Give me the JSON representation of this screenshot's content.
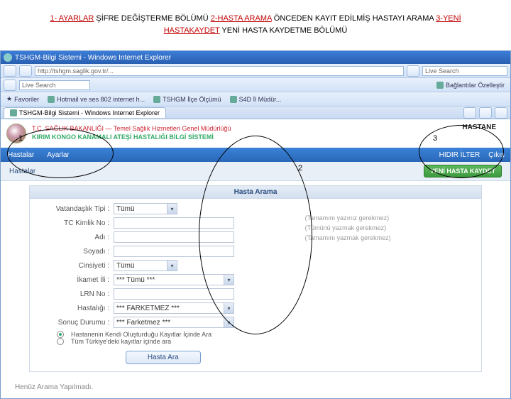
{
  "caption": {
    "seg1_label": "1- AYARLAR",
    "seg1_rest": " ŞİFRE DEĞİŞTERME BÖLÜMÜ ",
    "seg2_label": "2-HASTA ARAMA",
    "seg2_rest": " ÖNCEDEN KAYIT EDİLMİŞ HASTAYI ARAMA ",
    "seg3_label": "3-YENİ HASTAKAYDET",
    "seg3_rest": " YENİ HASTA KAYDETME BÖLÜMÜ"
  },
  "browser": {
    "title": "TSHGM-Bilgi Sistemi - Windows Internet Explorer",
    "address": "http://tshgm.saglik.gov.tr/...",
    "fav_label": "Favoriler",
    "linkbar1": "Hotmail  ve ses 802 internet h...",
    "linkbar2": "TSHGM İlçe Ölçümü",
    "linkbar3": "S4D İl Müdür...",
    "search_placeholder": "Live Search",
    "links_label": "Bağlantılar Özelleştir"
  },
  "header": {
    "line1": "T.C. SAĞLIK BAKANLIĞI — Temel Sağlık Hizmetleri Genel Müdürlüğü",
    "line2": "KIRIM KONGO KANAMALI ATEŞİ HASTALIĞI BİLGİ SİSTEMİ",
    "hastane": "HASTANE"
  },
  "nav": {
    "hastalar": "Hastalar",
    "ayarlar": "Ayarlar",
    "user": "HIDIR İLTER",
    "cikis": "Çıkış"
  },
  "subbar": {
    "left": "Hastalar",
    "btn": "YENİ HASTA KAYDET"
  },
  "panel": {
    "title": "Hasta Arama",
    "rows": {
      "vatandaslik": {
        "label": "Vatandaşlık Tipi :",
        "value": "Tümü"
      },
      "tckimlik": {
        "label": "TC Kimlik No :",
        "value": ""
      },
      "adi": {
        "label": "Adı :",
        "value": ""
      },
      "soyadi": {
        "label": "Soyadı :",
        "value": ""
      },
      "cinsiyeti": {
        "label": "Cinsiyeti :",
        "value": "Tümü"
      },
      "ikamet": {
        "label": "İkamet İli :",
        "value": "*** Tümü ***"
      },
      "lrn": {
        "label": "LRN No :",
        "value": ""
      },
      "hastaligi": {
        "label": "Hastalığı :",
        "value": "*** FARKETMEZ ***"
      },
      "sonuc": {
        "label": "Sonuç Durumu :",
        "value": "*** Farketmez ***"
      }
    },
    "hints": {
      "h1": "(Tamamını yazınız gerekmez)",
      "h2": "(Tümünü yazmak gerekmez)",
      "h3": "(Tamamını yazmak gerekmez)"
    },
    "radio1": "Hastanenin Kendi Oluşturduğu Kayıtlar İçinde Ara",
    "radio2": "Tüm Türkiye'deki kayıtlar içinde ara",
    "search_btn": "Hasta Ara"
  },
  "footer": "Henüz Arama Yapılmadı.",
  "markers": {
    "m1": "1",
    "m2": "2",
    "m3": "3"
  }
}
